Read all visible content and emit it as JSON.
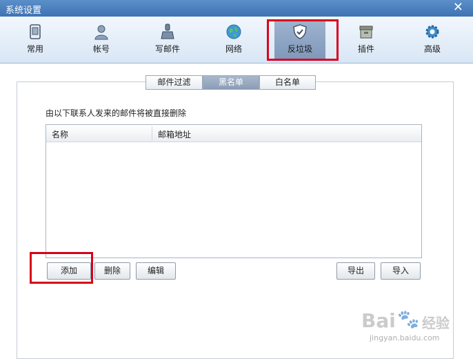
{
  "window": {
    "title": "系统设置",
    "close_glyph": "✕"
  },
  "toolbar": {
    "items": [
      {
        "label": "常用",
        "icon": "settings-icon"
      },
      {
        "label": "帐号",
        "icon": "user-icon"
      },
      {
        "label": "写邮件",
        "icon": "compose-icon"
      },
      {
        "label": "网络",
        "icon": "globe-icon"
      },
      {
        "label": "反垃圾",
        "icon": "shield-icon",
        "active": true
      },
      {
        "label": "插件",
        "icon": "box-icon"
      },
      {
        "label": "高级",
        "icon": "gear-icon"
      }
    ],
    "highlight_color": "#d9001b"
  },
  "tabs": [
    {
      "label": "邮件过滤"
    },
    {
      "label": "黑名单",
      "active": true
    },
    {
      "label": "白名单"
    }
  ],
  "blacklist": {
    "description": "由以下联系人发来的邮件将被直接删除",
    "columns": [
      "名称",
      "邮箱地址"
    ],
    "rows": []
  },
  "buttons": {
    "add": "添加",
    "delete": "删除",
    "edit": "编辑",
    "export": "导出",
    "import": "导入"
  },
  "watermark": {
    "logo": "Bai",
    "brand": "经验",
    "url": "jingyan.baidu.com"
  }
}
